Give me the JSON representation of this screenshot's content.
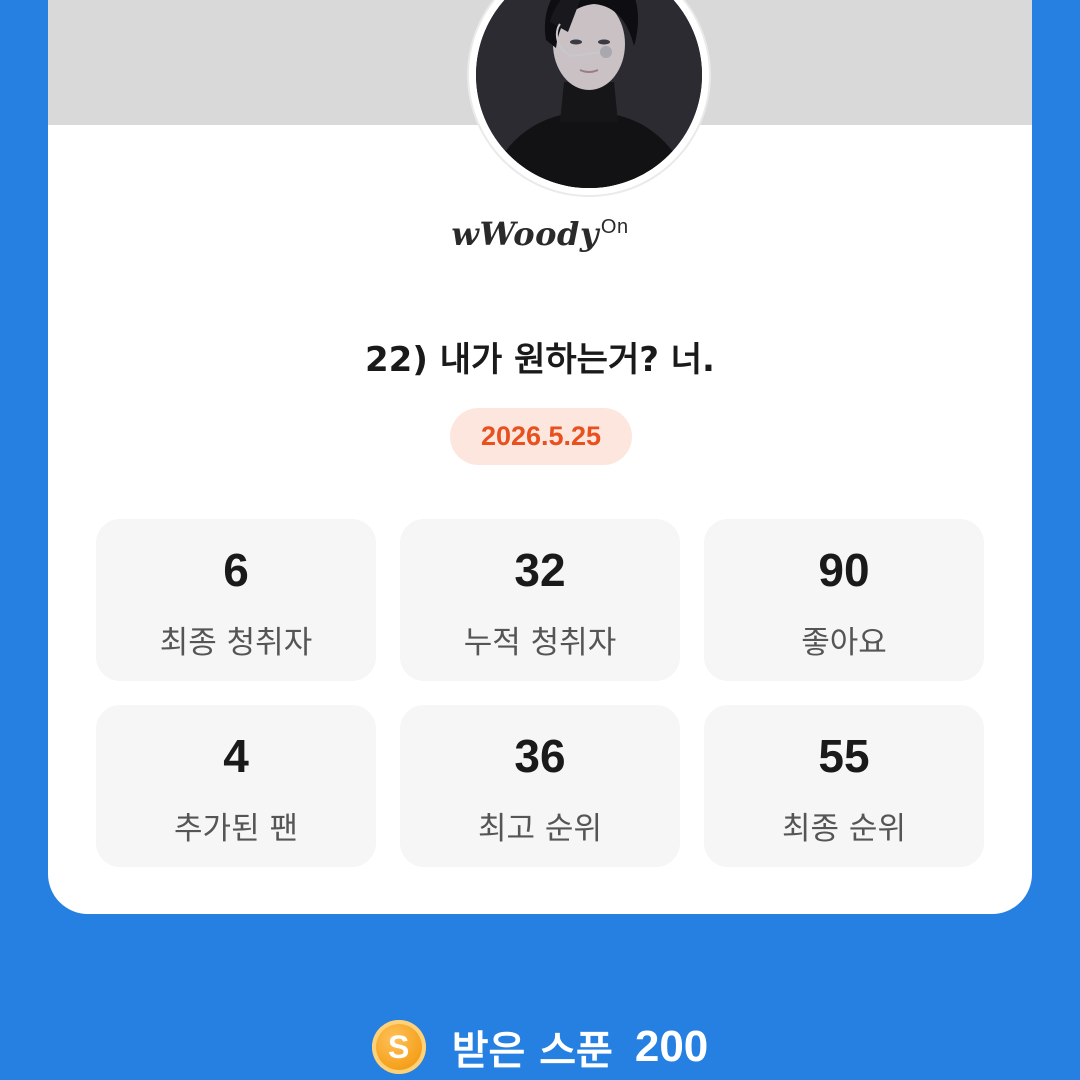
{
  "profile": {
    "signature_text": "wWoody",
    "signature_sup": "On"
  },
  "episode": {
    "title": "22) 내가 원하는거? 너.",
    "date": "2026.5.25"
  },
  "stats": [
    {
      "value": "6",
      "label": "최종 청취자"
    },
    {
      "value": "32",
      "label": "누적 청취자"
    },
    {
      "value": "90",
      "label": "좋아요"
    },
    {
      "value": "4",
      "label": "추가된 팬"
    },
    {
      "value": "36",
      "label": "최고 순위"
    },
    {
      "value": "55",
      "label": "최종 순위"
    }
  ],
  "reward": {
    "coin_letter": "S",
    "label": "받은 스푼",
    "count": "200"
  },
  "colors": {
    "background": "#2580e1",
    "date_text": "#e8501e",
    "date_bg": "#fde6de",
    "coin": "#f5a21e"
  },
  "icons": {
    "coin": "spoon-coin-icon"
  }
}
